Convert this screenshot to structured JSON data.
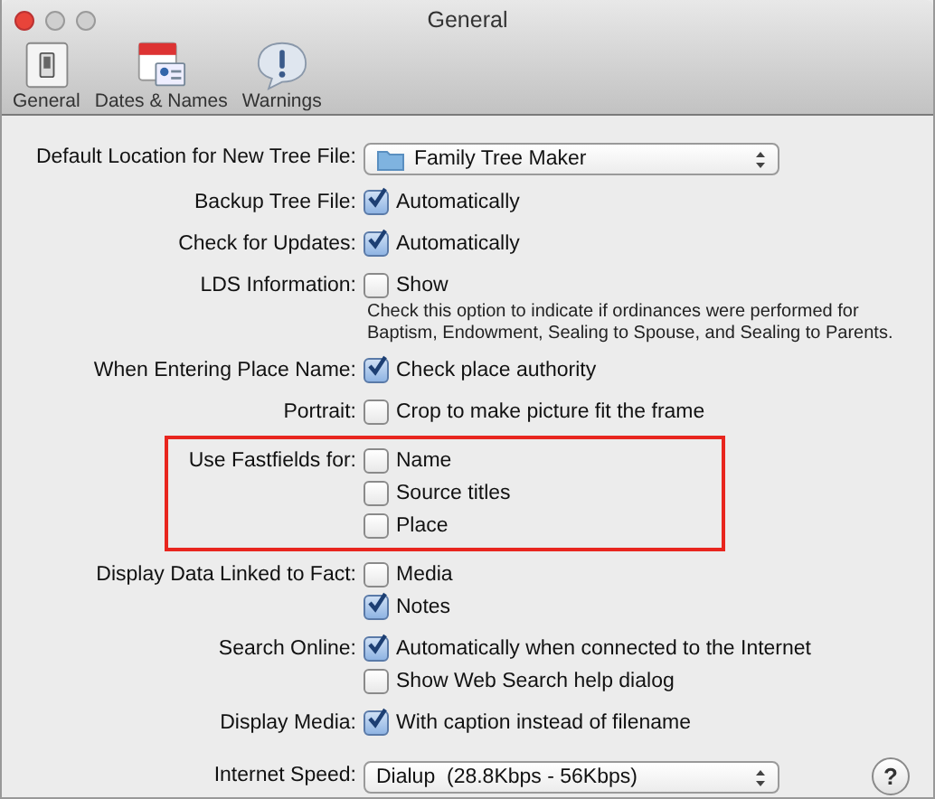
{
  "window": {
    "title": "General"
  },
  "toolbar": [
    {
      "label": "General"
    },
    {
      "label": "Dates & Names"
    },
    {
      "label": "Warnings"
    }
  ],
  "rows": [
    {
      "label": "Default Location for New Tree File:",
      "items": [
        {
          "kind": "select",
          "value": "Family Tree Maker",
          "folder": true
        }
      ]
    },
    {
      "label": "Backup Tree File:",
      "items": [
        {
          "kind": "checkbox",
          "label": "Automatically",
          "checked": true
        }
      ]
    },
    {
      "label": "Check for Updates:",
      "items": [
        {
          "kind": "checkbox",
          "label": "Automatically",
          "checked": true
        }
      ]
    },
    {
      "label": "LDS Information:",
      "items": [
        {
          "kind": "checkbox",
          "label": "Show",
          "checked": false
        },
        {
          "kind": "note",
          "text": "Check this option to indicate if ordinances were performed for Baptism, Endowment, Sealing to Spouse, and Sealing to Parents."
        }
      ]
    },
    {
      "label": "When Entering Place Name:",
      "items": [
        {
          "kind": "checkbox",
          "label": "Check place authority",
          "checked": true
        }
      ]
    },
    {
      "label": "Portrait:",
      "items": [
        {
          "kind": "checkbox",
          "label": "Crop to make picture fit the frame",
          "checked": false
        }
      ]
    },
    {
      "label": "Use Fastfields for:",
      "highlighted": true,
      "items": [
        {
          "kind": "checkbox",
          "label": "Name",
          "checked": false
        },
        {
          "kind": "checkbox",
          "label": "Source titles",
          "checked": false
        },
        {
          "kind": "checkbox",
          "label": "Place",
          "checked": false
        }
      ]
    },
    {
      "label": "Display Data Linked to Fact:",
      "items": [
        {
          "kind": "checkbox",
          "label": "Media",
          "checked": false
        },
        {
          "kind": "checkbox",
          "label": "Notes",
          "checked": true
        }
      ]
    },
    {
      "label": "Search Online:",
      "items": [
        {
          "kind": "checkbox",
          "label": "Automatically when connected to the Internet",
          "checked": true
        },
        {
          "kind": "checkbox",
          "label": "Show Web Search help dialog",
          "checked": false
        }
      ]
    },
    {
      "label": "Display Media:",
      "items": [
        {
          "kind": "checkbox",
          "label": "With caption instead of filename",
          "checked": true
        }
      ]
    },
    {
      "label": "Internet Speed:",
      "items": [
        {
          "kind": "select",
          "value": "Dialup  (28.8Kbps - 56Kbps)",
          "folder": false
        }
      ]
    }
  ],
  "help_button": "?"
}
